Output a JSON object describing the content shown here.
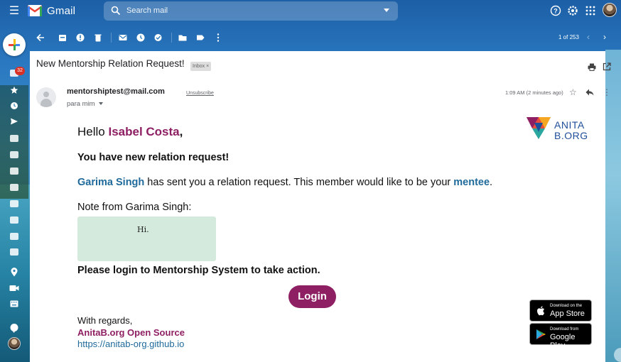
{
  "app": {
    "name": "Gmail",
    "search_placeholder": "Search mail"
  },
  "sidebar": {
    "inbox_badge": "32"
  },
  "toolbar": {
    "pager": "1 of 253"
  },
  "message": {
    "subject": "New Mentorship Relation Request!",
    "label_chip": "Inbox ×",
    "sender": "mentorshiptest@mail.com",
    "unsubscribe": "Unsubscribe",
    "to_line": "para mim",
    "timestamp": "1:09 AM (2 minutes ago)"
  },
  "email": {
    "greeting": "Hello ",
    "recipient": "Isabel Costa",
    "greeting_end": ",",
    "headline": "You have new relation request!",
    "mentor_name": "Garima Singh",
    "request_text": " has sent you a relation request. This member would like to be your ",
    "role": "mentee",
    "request_end": ".",
    "note_label": "Note from Garima Singh:",
    "note_text": "Hi.",
    "cta": "Please login to Mentorship System to take action.",
    "login_label": "Login",
    "regards": "With regards,",
    "org": "AnitaB.org Open Source",
    "site": "https://anitab-org.github.io",
    "logo_line1": "ANITA",
    "logo_line2": "B.ORG",
    "appstore_small": "Download on the",
    "appstore_big": "App Store",
    "googleplay_small": "Download from",
    "googleplay_big": "Google Play"
  },
  "colors": {
    "brand_purple": "#8e1f63",
    "link_blue": "#1f6a9b",
    "note_bg": "#d4eadc"
  }
}
